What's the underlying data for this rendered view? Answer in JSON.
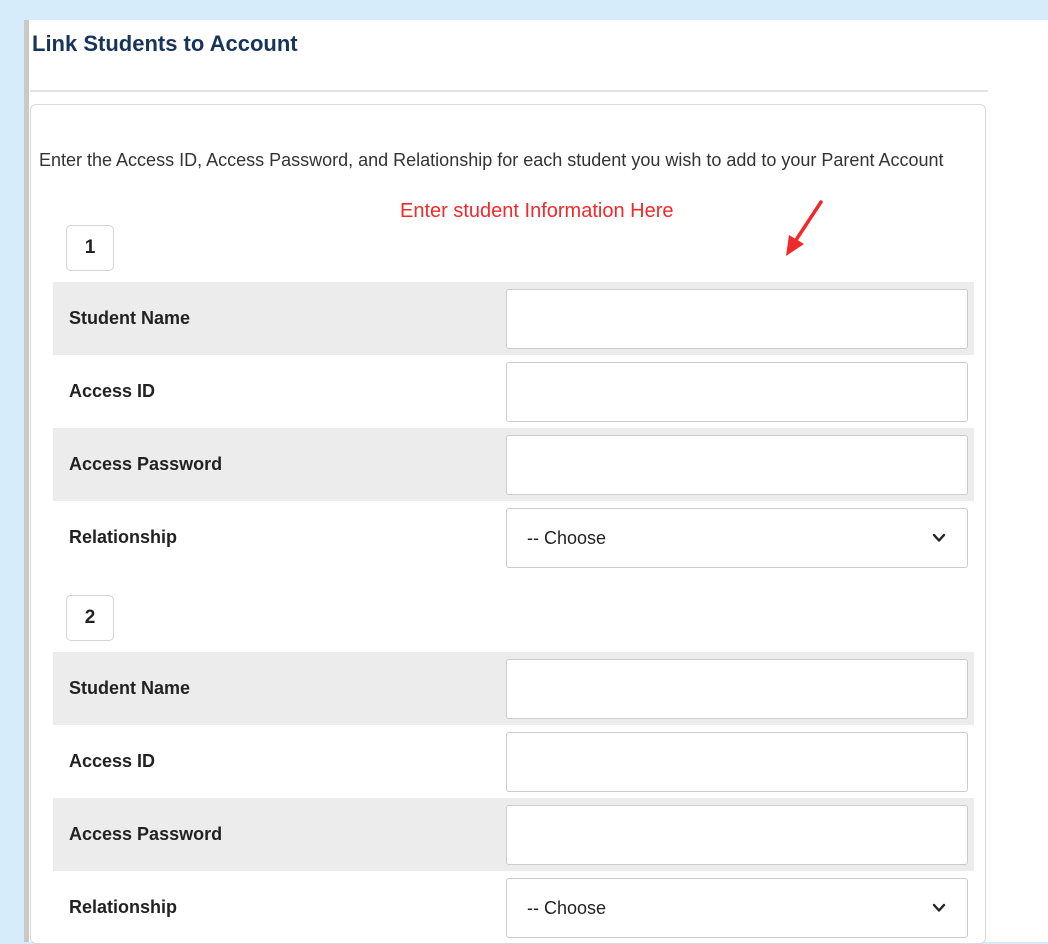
{
  "page": {
    "title": "Link Students to Account",
    "intro_text": "Enter the Access ID, Access Password, and Relationship for each student you wish to add to your Parent Account",
    "annotation": "Enter student Information Here"
  },
  "students": [
    {
      "number": "1",
      "fields": {
        "student_name": {
          "label": "Student Name",
          "value": ""
        },
        "access_id": {
          "label": "Access ID",
          "value": ""
        },
        "access_password": {
          "label": "Access Password",
          "value": ""
        },
        "relationship": {
          "label": "Relationship",
          "selected": "-- Choose"
        }
      }
    },
    {
      "number": "2",
      "fields": {
        "student_name": {
          "label": "Student Name",
          "value": ""
        },
        "access_id": {
          "label": "Access ID",
          "value": ""
        },
        "access_password": {
          "label": "Access Password",
          "value": ""
        },
        "relationship": {
          "label": "Relationship",
          "selected": "-- Choose"
        }
      }
    }
  ],
  "colors": {
    "page_background": "#d7ecfb",
    "title_color": "#17345a",
    "annotation_color": "#f02a2a",
    "shaded_row": "#ececec"
  },
  "icons": {
    "annotation_arrow": "red-arrow-icon",
    "select_chevron": "chevron-down-icon"
  }
}
